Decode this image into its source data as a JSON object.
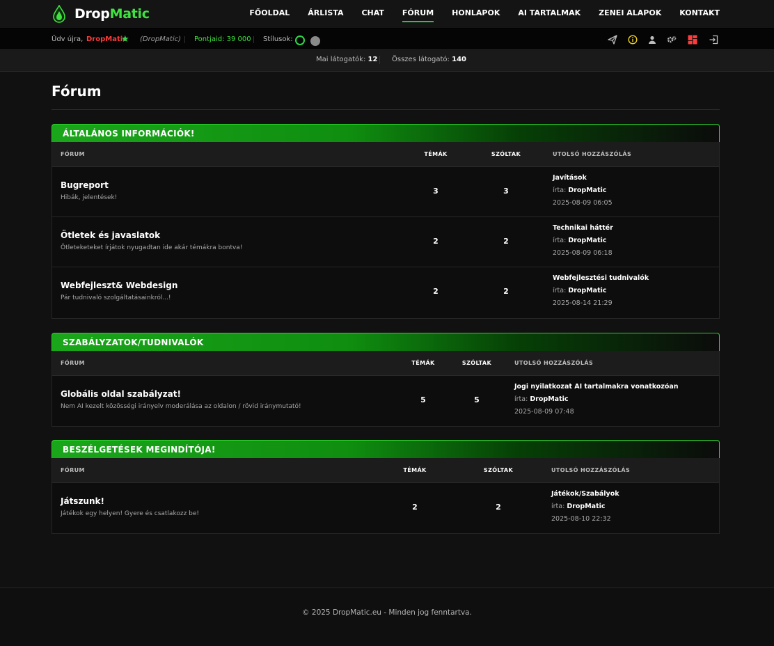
{
  "brand": {
    "name_white": "Drop",
    "name_green": "Matic",
    "accent": "#3fe23f"
  },
  "nav": {
    "items": [
      {
        "label": "FŐOLDAL"
      },
      {
        "label": "ÁRLISTA"
      },
      {
        "label": "CHAT"
      },
      {
        "label": "FÓRUM",
        "active": true
      },
      {
        "label": "HONLAPOK"
      },
      {
        "label": "AI TARTALMAK"
      },
      {
        "label": "ZENEI ALAPOK"
      },
      {
        "label": "KONTAKT"
      }
    ]
  },
  "userbar": {
    "welcome": "Üdv újra,",
    "username": "DropMatic",
    "alias": "(DropMatic)",
    "points": "Pontjaid: 39 000",
    "styles_label": "Stílusok:",
    "icons": [
      "send-icon",
      "info-icon",
      "user-icon",
      "settings-icon",
      "dashboard-icon",
      "logout-icon"
    ]
  },
  "visitors": {
    "today_label": "Mai látogatók:",
    "today_value": "12",
    "total_label": "Összes látogató:",
    "total_value": "140"
  },
  "page": {
    "title": "Fórum"
  },
  "sections": [
    {
      "title": "ÁLTALÁNOS INFORMÁCIÓK!",
      "cols": {
        "forum": "FÓRUM",
        "topics": "TÉMÁK",
        "posts": "SZÓLTAK",
        "last": "UTOLSÓ HOZZÁSZÓLÁS"
      },
      "rows": [
        {
          "name": "Bugreport",
          "desc": "Hibák, jelentések!",
          "topics": "3",
          "posts": "3",
          "last_title": "Javítások",
          "by_label": "írta:",
          "by": "DropMatic",
          "date": "2025-08-09 06:05"
        },
        {
          "name": "Ötletek és javaslatok",
          "desc": "Ötleteketeket írjátok nyugadtan ide akár témákra bontva!",
          "topics": "2",
          "posts": "2",
          "last_title": "Technikai háttér",
          "by_label": "írta:",
          "by": "DropMatic",
          "date": "2025-08-09 06:18"
        },
        {
          "name": "Webfejleszt& Webdesign",
          "desc": "Pár tudnivaló szolgáltatásainkról...!",
          "topics": "2",
          "posts": "2",
          "last_title": "Webfejlesztési tudnivalók",
          "by_label": "írta:",
          "by": "DropMatic",
          "date": "2025-08-14 21:29"
        }
      ]
    },
    {
      "title": "SZABÁLYZATOK/TUDNIVALÓK",
      "cols": {
        "forum": "FÓRUM",
        "topics": "TÉMÁK",
        "posts": "SZÓLTAK",
        "last": "UTOLSÓ HOZZÁSZÓLÁS"
      },
      "rows": [
        {
          "name": "Globális oldal szabályzat!",
          "desc": "Nem AI kezelt közösségi irányelv moderálása az oldalon / rövid iránymutató!",
          "topics": "5",
          "posts": "5",
          "last_title": "Jogi nyilatkozat AI tartalmakra vonatkozóan",
          "by_label": "írta:",
          "by": "DropMatic",
          "date": "2025-08-09 07:48"
        }
      ]
    },
    {
      "title": "BESZÉLGETÉSEK MEGINDÍTÓJA!",
      "cols": {
        "forum": "FÓRUM",
        "topics": "TÉMÁK",
        "posts": "SZÓLTAK",
        "last": "UTOLSÓ HOZZÁSZÓLÁS"
      },
      "rows": [
        {
          "name": "Játszunk!",
          "desc": "Játékok egy helyen! Gyere és csatlakozz be!",
          "topics": "2",
          "posts": "2",
          "last_title": "Játékok/Szabályok",
          "by_label": "írta:",
          "by": "DropMatic",
          "date": "2025-08-10 22:32"
        }
      ]
    }
  ],
  "footer": {
    "copyright": "© 2025 DropMatic.eu - Minden jog fenntartva."
  }
}
